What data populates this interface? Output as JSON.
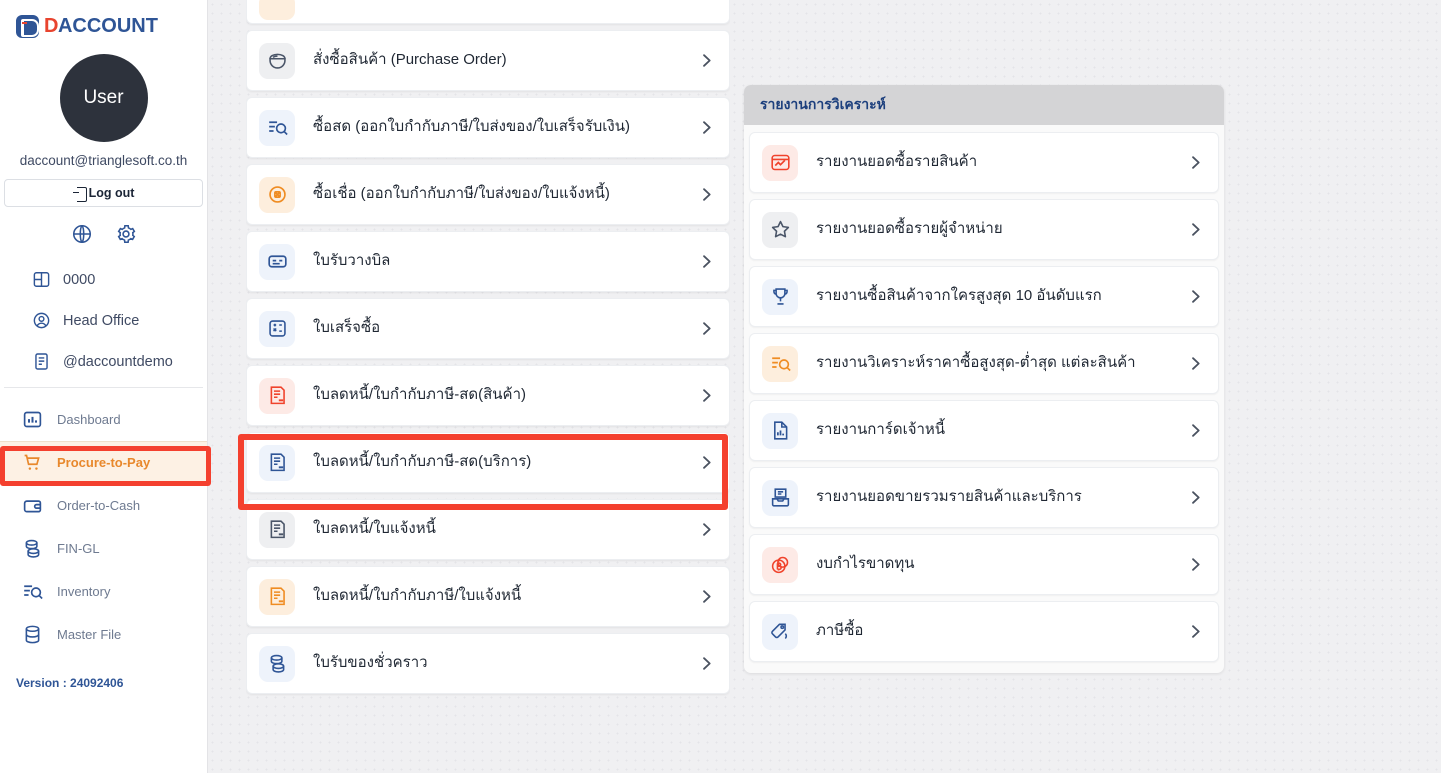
{
  "brand": {
    "logo_d": "D",
    "logo_rest": "ACCOUNT",
    "logo_alt": "DACCOUNT"
  },
  "sidebar": {
    "avatar_label": "User",
    "email": "daccount@trianglesoft.co.th",
    "logout_label": "Log out",
    "tools": [
      {
        "name": "language-globe-icon",
        "label": "globe"
      },
      {
        "name": "settings-gear-icon",
        "label": "gear"
      }
    ],
    "info_items": [
      {
        "icon": "layout-panel-icon",
        "label": "0000"
      },
      {
        "icon": "user-circle-icon",
        "label": "Head Office"
      },
      {
        "icon": "document-icon",
        "label": "@daccountdemo"
      }
    ],
    "nav_items": [
      {
        "icon": "bar-chart-icon",
        "label": "Dashboard",
        "active": false
      },
      {
        "icon": "shopping-cart-icon",
        "label": "Procure-to-Pay",
        "active": true
      },
      {
        "icon": "wallet-icon",
        "label": "Order-to-Cash",
        "active": false
      },
      {
        "icon": "coins-stack-icon",
        "label": "FIN-GL",
        "active": false
      },
      {
        "icon": "list-search-icon",
        "label": "Inventory",
        "active": false
      },
      {
        "icon": "database-icon",
        "label": "Master File",
        "active": false
      }
    ],
    "version": "Version : 24092406"
  },
  "center_panel": {
    "items": [
      {
        "icon": "bowl-icon",
        "tone": "gray",
        "label": "สั่งซื้อสินค้า (Purchase Order)",
        "highlighted": false
      },
      {
        "icon": "list-search-icon",
        "tone": "blue",
        "label": "ซื้อสด (ออกใบกำกับภาษี/ใบส่งของ/ใบเสร็จรับเงิน)",
        "highlighted": false
      },
      {
        "icon": "credit-badge-icon",
        "tone": "orange",
        "label": "ซื้อเชื่อ (ออกใบกำกับภาษี/ใบส่งของ/ใบแจ้งหนี้)",
        "highlighted": false
      },
      {
        "icon": "bill-card-icon",
        "tone": "blue",
        "label": "ใบรับวางบิล",
        "highlighted": false
      },
      {
        "icon": "receipt-calc-icon",
        "tone": "blue",
        "label": "ใบเสร็จซื้อ",
        "highlighted": false
      },
      {
        "icon": "credit-note-icon",
        "tone": "red",
        "label": "ใบลดหนี้/ใบกำกับภาษี-สด(สินค้า)",
        "highlighted": true
      },
      {
        "icon": "credit-note-icon",
        "tone": "blue",
        "label": "ใบลดหนี้/ใบกำกับภาษี-สด(บริการ)",
        "highlighted": false
      },
      {
        "icon": "credit-note-icon",
        "tone": "gray",
        "label": "ใบลดหนี้/ใบแจ้งหนี้",
        "highlighted": false
      },
      {
        "icon": "credit-note-icon",
        "tone": "orange",
        "label": "ใบลดหนี้/ใบกำกับภาษี/ใบแจ้งหนี้",
        "highlighted": false
      },
      {
        "icon": "coins-stack-icon",
        "tone": "blue",
        "label": "ใบรับของชั่วคราว",
        "highlighted": false
      }
    ]
  },
  "right_panel": {
    "title": "รายงานการวิเคราะห์",
    "items": [
      {
        "icon": "chart-window-icon",
        "tone": "red",
        "label": "รายงานยอดซื้อรายสินค้า"
      },
      {
        "icon": "star-icon",
        "tone": "gray",
        "label": "รายงานยอดซื้อรายผู้จำหน่าย"
      },
      {
        "icon": "trophy-icon",
        "tone": "blue",
        "label": "รายงานซื้อสินค้าจากใครสูงสุด 10 อันดับแรก"
      },
      {
        "icon": "list-search-icon",
        "tone": "orange",
        "label": "รายงานวิเคราะห์ราคาซื้อสูงสุด-ต่ำสุด แต่ละสินค้า"
      },
      {
        "icon": "doc-chart-icon",
        "tone": "blue",
        "label": "รายงานการ์ดเจ้าหนี้"
      },
      {
        "icon": "inbox-doc-icon",
        "tone": "blue",
        "label": "รายงานยอดขายรวมรายสินค้าและบริการ"
      },
      {
        "icon": "baht-coin-icon",
        "tone": "red",
        "label": "งบกำไรขาดทุน"
      },
      {
        "icon": "tag-icon",
        "tone": "blue",
        "label": "ภาษีซื้อ"
      }
    ]
  },
  "annotations": {
    "sidebar_highlight_color": "#f4402e",
    "center_highlight_color": "#f4402e"
  },
  "colors": {
    "brand_blue": "#2f5596",
    "brand_red": "#e8442f",
    "accent_orange": "#e8882c",
    "page_bg": "#f0f0f2"
  }
}
